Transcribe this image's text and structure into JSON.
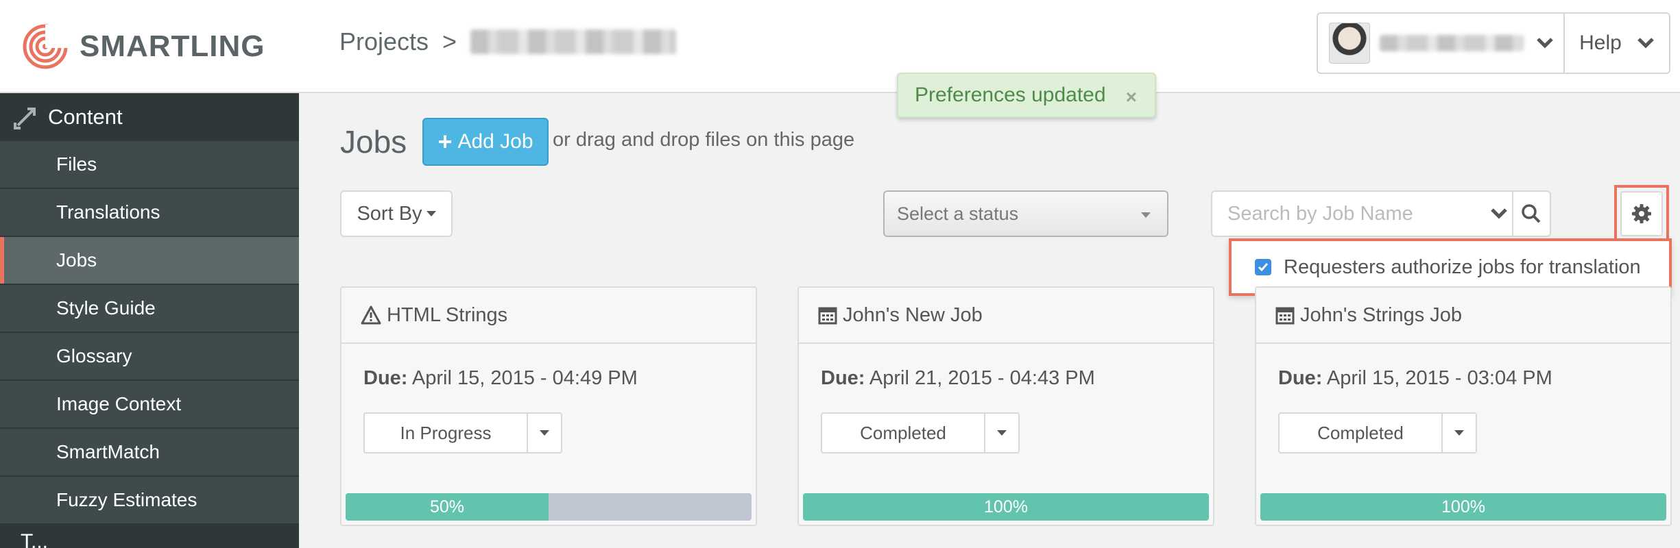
{
  "header": {
    "brand": "SMARTLING",
    "breadcrumb_projects": "Projects",
    "breadcrumb_sep": ">",
    "help_label": "Help"
  },
  "toast": {
    "message": "Preferences updated",
    "close": "×"
  },
  "sidebar": {
    "section_title": "Content",
    "items": [
      {
        "label": "Files"
      },
      {
        "label": "Translations"
      },
      {
        "label": "Jobs"
      },
      {
        "label": "Style Guide"
      },
      {
        "label": "Glossary"
      },
      {
        "label": "Image Context"
      },
      {
        "label": "SmartMatch"
      },
      {
        "label": "Fuzzy Estimates"
      }
    ],
    "active_index": 2,
    "next_section_title": "T..."
  },
  "main": {
    "title": "Jobs",
    "add_job_label": "Add Job",
    "drag_hint": "or drag and drop files on this page",
    "sort_label": "Sort By",
    "status_placeholder": "Select a status",
    "search_placeholder": "Search by Job Name",
    "preference_label": "Requesters authorize jobs for translation",
    "preference_checked": true
  },
  "cards": [
    {
      "icon": "warning-icon",
      "title": "HTML Strings",
      "due_label": "Due:",
      "due": "April 15, 2015 - 04:49 PM",
      "status": "In Progress",
      "progress": 50,
      "progress_label": "50%"
    },
    {
      "icon": "calendar-icon",
      "title": "John's New Job",
      "due_label": "Due:",
      "due": "April 21, 2015 - 04:43 PM",
      "status": "Completed",
      "progress": 100,
      "progress_label": "100%"
    },
    {
      "icon": "calendar-icon",
      "title": "John's Strings Job",
      "due_label": "Due:",
      "due": "April 15, 2015 - 03:04 PM",
      "status": "Completed",
      "progress": 100,
      "progress_label": "100%"
    }
  ],
  "colors": {
    "accent": "#e8735f",
    "primary_button": "#4db6e3",
    "sidebar_bg": "#3f4b4b",
    "progress_fill": "#62c4ae",
    "toast_bg": "#dff0d8"
  }
}
